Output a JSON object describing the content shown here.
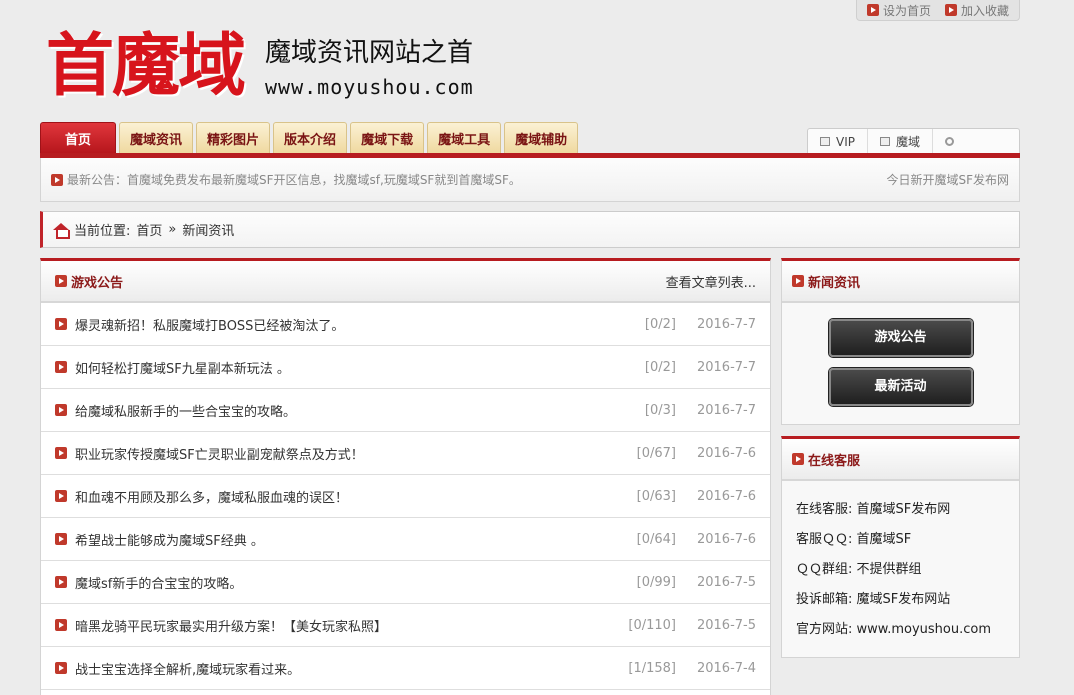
{
  "toplinks": {
    "set_home": "设为首页",
    "add_fav": "加入收藏"
  },
  "logo": {
    "brand": "首魔域",
    "slogan": "魔域资讯网站之首",
    "site": "www.moyushou.com"
  },
  "nav": {
    "tabs": [
      "首页",
      "魔域资讯",
      "精彩图片",
      "版本介绍",
      "魔域下载",
      "魔域工具",
      "魔域辅助"
    ],
    "right": [
      "VIP",
      "魔域",
      ""
    ]
  },
  "notice": {
    "text": "最新公告：首魔域免费发布最新魔域SF开区信息，找魔域sf,玩魔域SF就到首魔域SF。",
    "right": "今日新开魔域SF发布网"
  },
  "breadcrumb": {
    "prefix": "当前位置:",
    "home": "首页",
    "sep": "»",
    "current": "新闻资讯"
  },
  "main": {
    "title": "游戏公告",
    "more": "查看文章列表...",
    "rows": [
      {
        "title": "爆灵魂新招！私服魔域打BOSS已经被淘汰了。",
        "count": "[0/2]",
        "date": "2016-7-7"
      },
      {
        "title": "如何轻松打魔域SF九星副本新玩法 。",
        "count": "[0/2]",
        "date": "2016-7-7"
      },
      {
        "title": "给魔域私服新手的一些合宝宝的攻略。",
        "count": "[0/3]",
        "date": "2016-7-7"
      },
      {
        "title": "职业玩家传授魔域SF亡灵职业副宠献祭点及方式！",
        "count": "[0/67]",
        "date": "2016-7-6"
      },
      {
        "title": "和血魂不用顾及那么多，魔域私服血魂的误区！",
        "count": "[0/63]",
        "date": "2016-7-6"
      },
      {
        "title": "希望战士能够成为魔域SF经典 。",
        "count": "[0/64]",
        "date": "2016-7-6"
      },
      {
        "title": "魔域sf新手的合宝宝的攻略。",
        "count": "[0/99]",
        "date": "2016-7-5"
      },
      {
        "title": "暗黑龙骑平民玩家最实用升级方案！【美女玩家私照】",
        "count": "[0/110]",
        "date": "2016-7-5"
      },
      {
        "title": "战士宝宝选择全解析,魔域玩家看过来。",
        "count": "[1/158]",
        "date": "2016-7-4"
      }
    ]
  },
  "side_news": {
    "title": "新闻资讯",
    "buttons": [
      "游戏公告",
      "最新活动"
    ]
  },
  "side_service": {
    "title": "在线客服",
    "lines": [
      "在线客服: 首魔域SF发布网",
      "客服ＱＱ: 首魔域SF",
      "ＱＱ群组: 不提供群组",
      "投诉邮箱: 魔域SF发布网站",
      "官方网站: www.moyushou.com"
    ]
  }
}
